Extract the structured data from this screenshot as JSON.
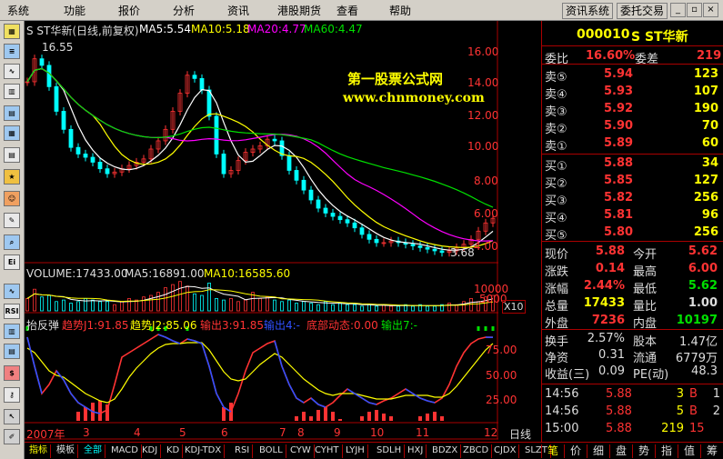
{
  "menu": {
    "items": [
      "系统",
      "功能",
      "报价",
      "分析",
      "资讯",
      "港股期货",
      "查看",
      "帮助"
    ],
    "right_buttons": [
      "资讯系统",
      "委托交易"
    ]
  },
  "chart": {
    "title": "S ST华新(日线,前复权)",
    "ma5": "MA5:5.54",
    "ma10": "MA10:5.18",
    "ma20": "MA20:4.77",
    "ma60": "MA60:4.47",
    "high_marker": "16.55",
    "low_marker": "3.68",
    "watermark_1": "第一股票公式网",
    "watermark_2": "www.chnmoney.com",
    "price_ticks": [
      "16.00",
      "14.00",
      "12.00",
      "10.00",
      "8.00",
      "6.00",
      "4.00"
    ],
    "volume_label": "VOLUME:17433.00",
    "vol_ma5": "MA5:16891.00",
    "vol_ma10": "MA10:16585.60",
    "volume_ticks": [
      "10000",
      "5000"
    ],
    "volume_unit": "X10",
    "indicator_name": "抬反弹",
    "ind_trend1": "趋势J1:91.85",
    "ind_trend2": "趋势J2:85.06",
    "ind_out3": "输出3:91.85",
    "ind_out4": "输出4:-",
    "ind_bottom": "底部动态:0.00",
    "ind_out7": "输出7:-",
    "ind_ticks": [
      "75.00",
      "50.00",
      "25.00"
    ],
    "date_labels": [
      "2007年",
      "3",
      "4",
      "5",
      "6",
      "7",
      "8",
      "9",
      "10",
      "11",
      "12"
    ],
    "period": "日线"
  },
  "quote": {
    "code": "000010",
    "name": "S ST华新",
    "weibi_label": "委比",
    "weibi": "16.60%",
    "weicha_label": "委差",
    "weicha": "219",
    "sells": [
      {
        "label": "卖⑤",
        "price": "5.94",
        "vol": "123"
      },
      {
        "label": "卖④",
        "price": "5.93",
        "vol": "107"
      },
      {
        "label": "卖③",
        "price": "5.92",
        "vol": "190"
      },
      {
        "label": "卖②",
        "price": "5.90",
        "vol": "70"
      },
      {
        "label": "卖①",
        "price": "5.89",
        "vol": "60"
      }
    ],
    "buys": [
      {
        "label": "买①",
        "price": "5.88",
        "vol": "34"
      },
      {
        "label": "买②",
        "price": "5.85",
        "vol": "127"
      },
      {
        "label": "买③",
        "price": "5.82",
        "vol": "256"
      },
      {
        "label": "买④",
        "price": "5.81",
        "vol": "96"
      },
      {
        "label": "买⑤",
        "price": "5.80",
        "vol": "256"
      }
    ],
    "stats": [
      {
        "l1": "现价",
        "v1": "5.88",
        "l2": "今开",
        "v2": "5.62"
      },
      {
        "l1": "涨跌",
        "v1": "0.14",
        "l2": "最高",
        "v2": "6.00"
      },
      {
        "l1": "涨幅",
        "v1": "2.44%",
        "l2": "最低",
        "v2": "5.62"
      },
      {
        "l1": "总量",
        "v1": "17433",
        "l2": "量比",
        "v2": "1.00"
      },
      {
        "l1": "外盘",
        "v1": "7236",
        "l2": "内盘",
        "v2": "10197"
      }
    ],
    "finance": [
      {
        "l1": "换手",
        "v1": "2.57%",
        "l2": "股本",
        "v2": "1.47亿"
      },
      {
        "l1": "净资",
        "v1": "0.31",
        "l2": "流通",
        "v2": "6779万"
      },
      {
        "l1": "收益(三)",
        "v1": "0.09",
        "l2": "PE(动)",
        "v2": "48.3"
      }
    ],
    "ticks": [
      {
        "time": "14:56",
        "price": "5.88",
        "vol": "3",
        "bs": "B",
        "n": "1"
      },
      {
        "time": "14:56",
        "price": "5.88",
        "vol": "5",
        "bs": "B",
        "n": "2"
      },
      {
        "time": "15:00",
        "price": "5.88",
        "vol": "219",
        "bs": "15",
        "n": ""
      }
    ]
  },
  "bottom_tabs": [
    "指标",
    "模板",
    "全部",
    "MACD",
    "KDJ",
    "KD",
    "KDJ-TDX",
    "RSI",
    "BOLL",
    "CYW",
    "CYHT",
    "LYJH",
    "SDLH",
    "HXJ",
    "BDZX",
    "ZBCD",
    "CJDX",
    "SLZT"
  ],
  "side_tabs": [
    "笔",
    "价",
    "细",
    "盘",
    "势",
    "指",
    "值",
    "筹"
  ],
  "colors": {
    "red": "#ff3333",
    "green": "#00e000",
    "yellow": "#ffff00",
    "white": "#ffffff",
    "magenta": "#ff00ff",
    "cyan": "#00ffff",
    "blue": "#3050ff"
  },
  "series": {
    "price": [
      14.2,
      15.6,
      15.2,
      13.9,
      12.4,
      11.3,
      10.2,
      9.8,
      9.6,
      9.3,
      8.9,
      8.6,
      8.7,
      8.9,
      9.1,
      9.3,
      9.5,
      10.1,
      10.6,
      11.3,
      12.4,
      13.5,
      14.6,
      14.4,
      13.7,
      12.1,
      9.8,
      8.6,
      8.8,
      9.4,
      9.9,
      10.1,
      10.3,
      10.7,
      10.6,
      9.7,
      8.8,
      8.2,
      7.6,
      7.0,
      6.5,
      6.2,
      6.0,
      5.8,
      5.6,
      5.3,
      4.9,
      4.6,
      4.4,
      4.4,
      4.5,
      4.4,
      4.3,
      4.2,
      4.1,
      4.0,
      3.9,
      3.8,
      3.9,
      4.1,
      4.3,
      4.6,
      5.1,
      5.6,
      5.88
    ],
    "volume": [
      0.4,
      0.7,
      0.45,
      0.5,
      0.3,
      0.35,
      0.25,
      0.3,
      0.4,
      0.35,
      0.3,
      0.3,
      0.2,
      0.3,
      0.4,
      0.35,
      0.45,
      0.5,
      0.6,
      0.75,
      0.85,
      0.95,
      0.8,
      0.55,
      0.5,
      0.9,
      0.4,
      0.35,
      0.4,
      0.3,
      0.35,
      0.6,
      0.4,
      0.45,
      0.35,
      0.3,
      0.35,
      0.25,
      0.3,
      0.25,
      0.2,
      0.3,
      0.2,
      0.25,
      0.2,
      0.2,
      0.15,
      0.2,
      0.15,
      0.2,
      0.15,
      0.15,
      0.2,
      0.15,
      0.2,
      0.15,
      0.15,
      0.2,
      0.25,
      0.2,
      0.3,
      0.4,
      0.3,
      0.45,
      0.5
    ],
    "ind_j1": [
      92,
      60,
      30,
      40,
      55,
      45,
      30,
      20,
      15,
      10,
      8,
      12,
      40,
      70,
      75,
      80,
      85,
      90,
      95,
      92,
      88,
      85,
      90,
      88,
      85,
      60,
      30,
      15,
      10,
      30,
      55,
      75,
      80,
      85,
      88,
      60,
      40,
      25,
      20,
      25,
      18,
      15,
      20,
      28,
      35,
      30,
      25,
      20,
      18,
      22,
      25,
      30,
      35,
      30,
      25,
      22,
      20,
      25,
      40,
      60,
      75,
      85,
      90,
      92,
      91.85
    ],
    "ind_j2": [
      80,
      75,
      65,
      55,
      50,
      48,
      42,
      36,
      30,
      26,
      22,
      20,
      24,
      35,
      48,
      58,
      66,
      74,
      80,
      84,
      85,
      85,
      86,
      86,
      86,
      78,
      66,
      54,
      46,
      44,
      46,
      54,
      62,
      68,
      74,
      70,
      62,
      54,
      46,
      40,
      34,
      30,
      28,
      30,
      30,
      30,
      28,
      26,
      24,
      24,
      24,
      26,
      28,
      28,
      28,
      28,
      26,
      26,
      30,
      38,
      48,
      58,
      68,
      78,
      85.06
    ]
  }
}
